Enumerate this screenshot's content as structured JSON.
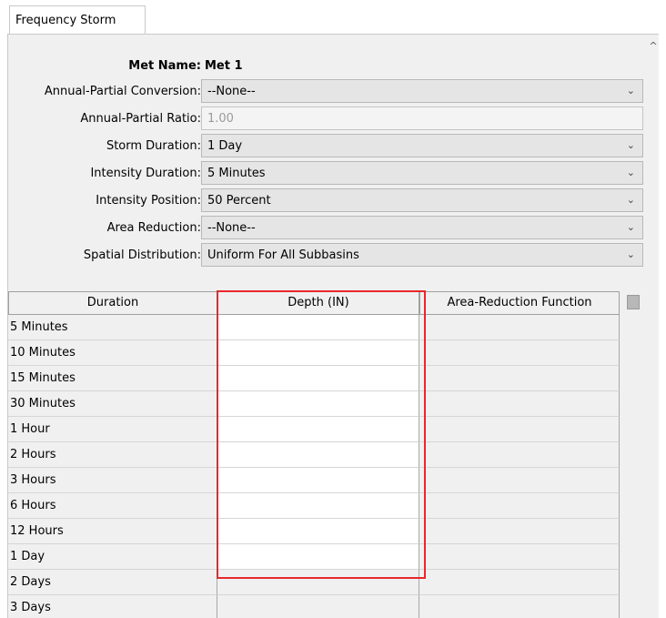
{
  "tab": {
    "label": "Frequency Storm"
  },
  "met_name": {
    "label": "Met Name:",
    "value": "Met 1"
  },
  "fields": [
    {
      "label": "Annual-Partial Conversion:",
      "value": "--None--",
      "kind": "combo"
    },
    {
      "label": "Annual-Partial Ratio:",
      "value": "1.00",
      "kind": "text-disabled"
    },
    {
      "label": "Storm Duration:",
      "value": "1 Day",
      "kind": "combo"
    },
    {
      "label": "Intensity Duration:",
      "value": "5 Minutes",
      "kind": "combo"
    },
    {
      "label": "Intensity Position:",
      "value": "50 Percent",
      "kind": "combo"
    },
    {
      "label": "Area Reduction:",
      "value": "--None--",
      "kind": "combo"
    },
    {
      "label": "Spatial Distribution:",
      "value": "Uniform For All Subbasins",
      "kind": "combo"
    }
  ],
  "table": {
    "columns": [
      "Duration",
      "Depth (IN)",
      "Area-Reduction Function"
    ],
    "rows": [
      {
        "duration": "5 Minutes",
        "depth": "",
        "arf": ""
      },
      {
        "duration": "10 Minutes",
        "depth": "",
        "arf": ""
      },
      {
        "duration": "15 Minutes",
        "depth": "",
        "arf": ""
      },
      {
        "duration": "30 Minutes",
        "depth": "",
        "arf": ""
      },
      {
        "duration": "1 Hour",
        "depth": "",
        "arf": ""
      },
      {
        "duration": "2 Hours",
        "depth": "",
        "arf": ""
      },
      {
        "duration": "3 Hours",
        "depth": "",
        "arf": ""
      },
      {
        "duration": "6 Hours",
        "depth": "",
        "arf": ""
      },
      {
        "duration": "12 Hours",
        "depth": "",
        "arf": ""
      },
      {
        "duration": "1 Day",
        "depth": "",
        "arf": ""
      },
      {
        "duration": "2 Days",
        "depth": "",
        "arf": ""
      },
      {
        "duration": "3 Days",
        "depth": "",
        "arf": ""
      }
    ]
  },
  "icons": {
    "dropdown": "chevron-down-icon",
    "scroll_up": "scroll-up-arrow-icon",
    "table_corner": "table-corner-icon"
  },
  "colors": {
    "highlight": "#e8282d",
    "panel_bg": "#f0f0f0"
  }
}
